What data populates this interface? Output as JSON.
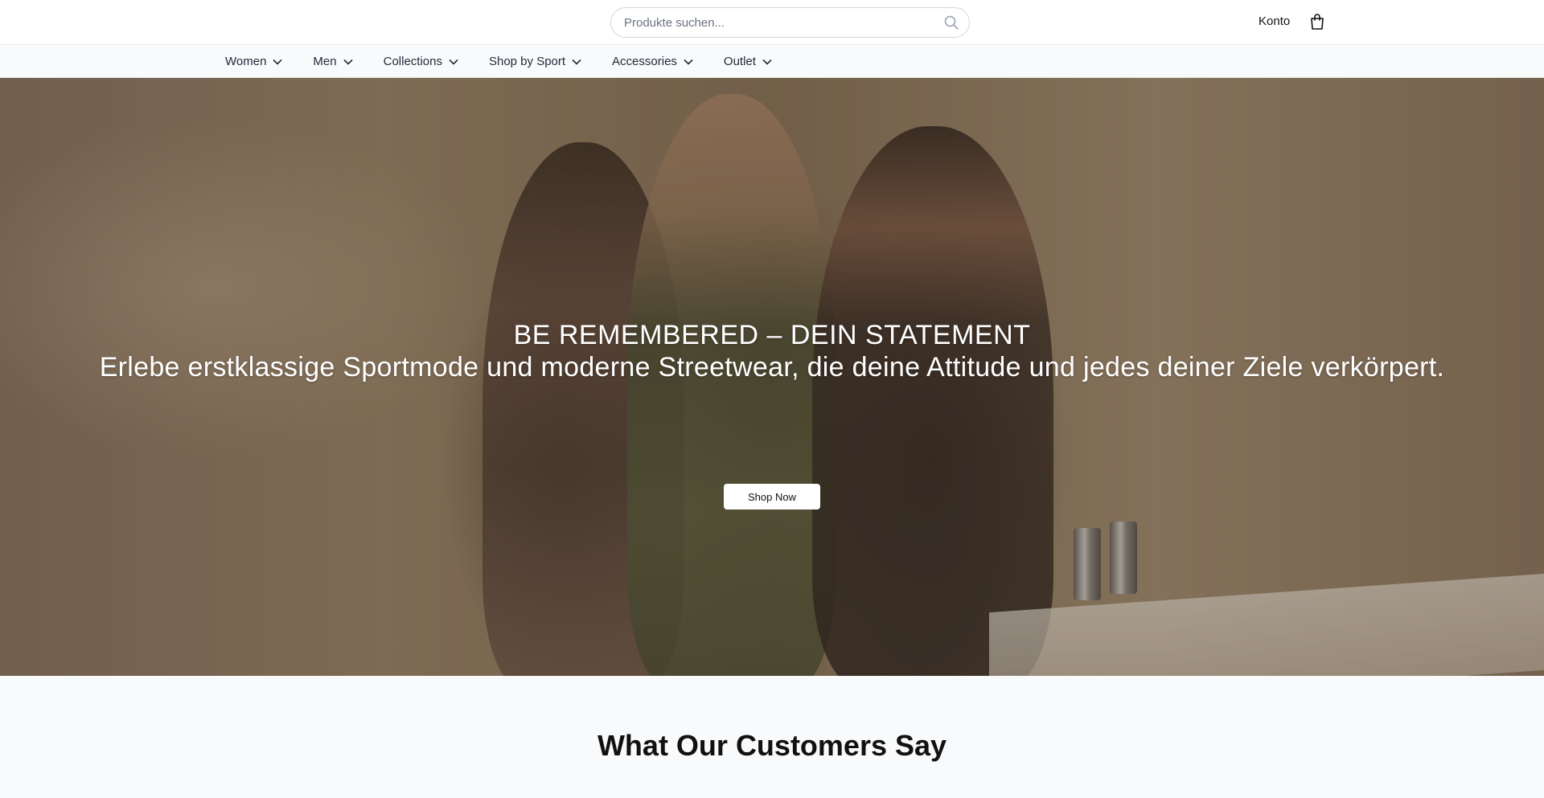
{
  "header": {
    "search": {
      "placeholder": "Produkte suchen...",
      "value": ""
    },
    "account_label": "Konto",
    "icons": {
      "search": "search-icon",
      "cart": "shopping-bag-icon"
    }
  },
  "nav": {
    "items": [
      {
        "label": "Women"
      },
      {
        "label": "Men"
      },
      {
        "label": "Collections"
      },
      {
        "label": "Shop by Sport"
      },
      {
        "label": "Accessories"
      },
      {
        "label": "Outlet"
      }
    ]
  },
  "hero": {
    "title": "BE REMEMBERED – DEIN STATEMENT",
    "subtitle": "Erlebe erstklassige Sportmode und moderne Streetwear, die deine Attitude und jedes deiner Ziele verkörpert.",
    "cta_label": "Shop Now"
  },
  "testimonials": {
    "heading": "What Our Customers Say"
  }
}
